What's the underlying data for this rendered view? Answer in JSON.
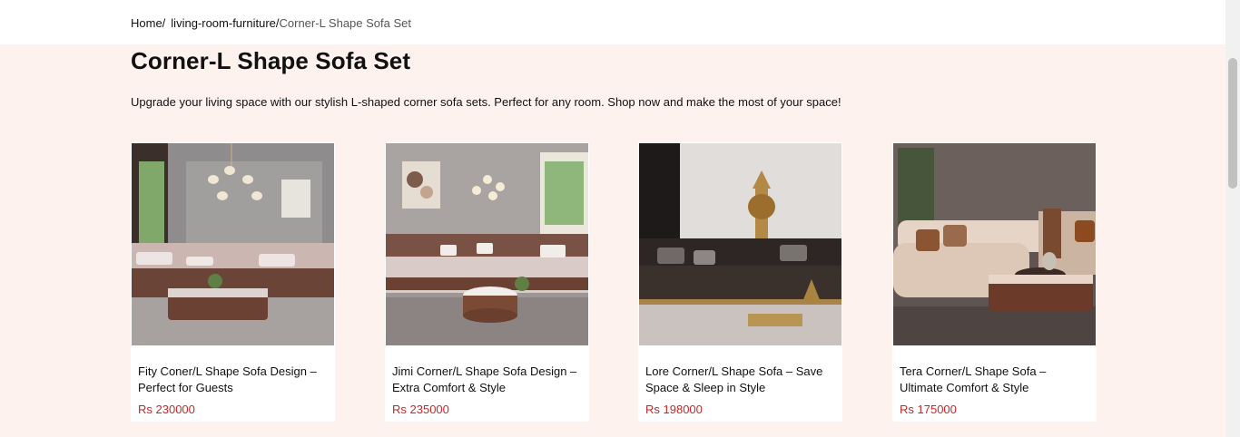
{
  "breadcrumb": {
    "home": "Home/",
    "category": "living-room-furniture/",
    "current": "Corner-L Shape Sofa Set"
  },
  "page": {
    "title": "Corner-L Shape Sofa Set",
    "description": "Upgrade your living space with our stylish L-shaped corner sofa sets. Perfect for any room. Shop now and make the most of your space!"
  },
  "products": [
    {
      "name": "Fity Coner/L Shape Sofa Design – Perfect for Guests",
      "price": "Rs 230000"
    },
    {
      "name": "Jimi Corner/L Shape Sofa Design – Extra Comfort & Style",
      "price": "Rs 235000"
    },
    {
      "name": "Lore Corner/L Shape Sofa – Save Space & Sleep in Style",
      "price": "Rs 198000"
    },
    {
      "name": "Tera Corner/L Shape Sofa – Ultimate Comfort & Style",
      "price": "Rs 175000"
    }
  ],
  "colors": {
    "page_background": "#fdf2ee",
    "price": "#c62828"
  }
}
